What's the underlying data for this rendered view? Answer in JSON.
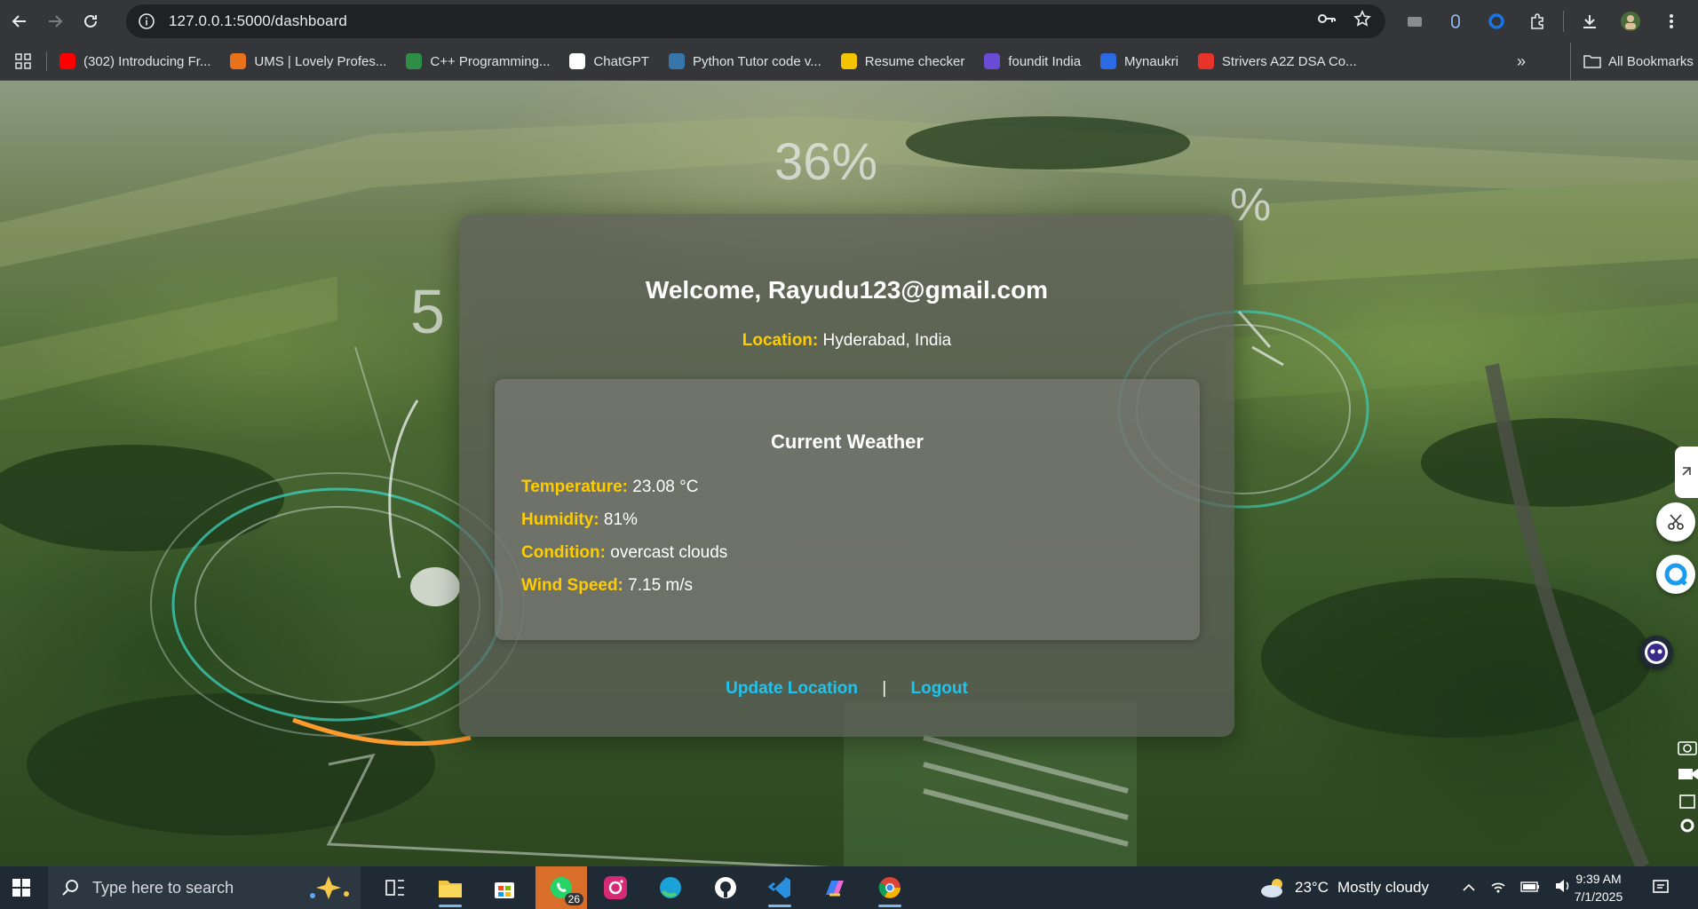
{
  "browser": {
    "url": "127.0.0.1:5000/dashboard",
    "bookmarks": [
      {
        "label": "(302) Introducing Fr...",
        "icon": "youtube-icon",
        "color": "#ff0000"
      },
      {
        "label": "UMS | Lovely Profes...",
        "icon": "lpu-icon",
        "color": "#e8711a"
      },
      {
        "label": "C++ Programming...",
        "icon": "gfg-icon",
        "color": "#2f8d46"
      },
      {
        "label": "ChatGPT",
        "icon": "chatgpt-icon",
        "color": "#ffffff"
      },
      {
        "label": "Python Tutor code v...",
        "icon": "python-icon",
        "color": "#3776ab"
      },
      {
        "label": "Resume checker",
        "icon": "resume-icon",
        "color": "#f5c400"
      },
      {
        "label": "foundit India",
        "icon": "foundit-icon",
        "color": "#6a4bd6"
      },
      {
        "label": "Mynaukri",
        "icon": "mynaukri-icon",
        "color": "#2c6ae6"
      },
      {
        "label": "Strivers A2Z DSA Co...",
        "icon": "tuf-icon",
        "color": "#e8332a"
      }
    ],
    "all_bookmarks_label": "All Bookmarks"
  },
  "hud": {
    "top_percent": "36%",
    "right_percent": "%",
    "left_number": "5"
  },
  "dashboard": {
    "welcome": "Welcome, Rayudu123@gmail.com",
    "location_label": "Location:",
    "location_value": "Hyderabad, India",
    "weather_title": "Current Weather",
    "rows": [
      {
        "label": "Temperature:",
        "value": "23.08 °C"
      },
      {
        "label": "Humidity:",
        "value": "81%"
      },
      {
        "label": "Condition:",
        "value": "overcast clouds"
      },
      {
        "label": "Wind Speed:",
        "value": "7.15 m/s"
      }
    ],
    "update_location_link": "Update Location",
    "link_separator": "|",
    "logout_link": "Logout"
  },
  "taskbar": {
    "search_placeholder": "Type here to search",
    "whatsapp_badge": "26",
    "weather_temp": "23°C",
    "weather_text": "Mostly cloudy",
    "time": "9:39 AM",
    "date": "7/1/2025"
  },
  "colors": {
    "accent_yellow": "#ffcc00",
    "link_cyan": "#1ec4f0"
  }
}
